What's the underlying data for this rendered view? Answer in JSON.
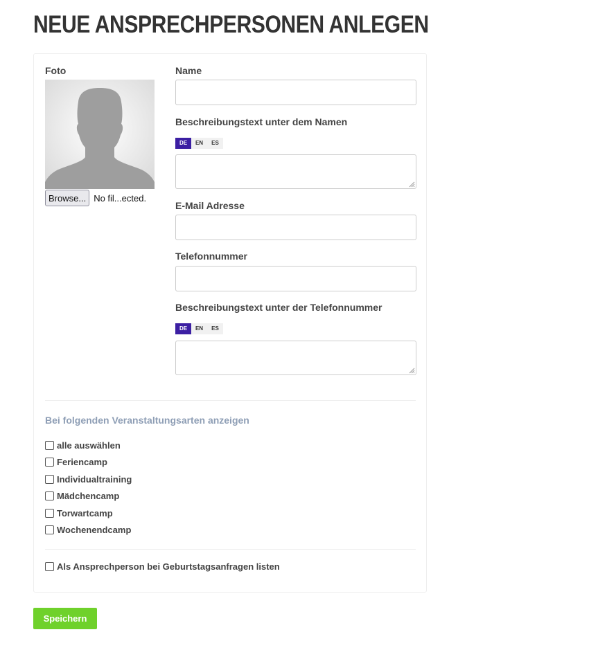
{
  "page": {
    "title": "NEUE ANSPRECHPERSONEN ANLEGEN"
  },
  "photo": {
    "label": "Foto",
    "placeholder_icon": "person-silhouette-icon",
    "browse_label": "Browse...",
    "file_status": "No fil...ected."
  },
  "fields": {
    "name": {
      "label": "Name",
      "value": ""
    },
    "description_name": {
      "label": "Beschreibungstext unter dem Namen",
      "value": ""
    },
    "email": {
      "label": "E-Mail Adresse",
      "value": ""
    },
    "phone": {
      "label": "Telefonnummer",
      "value": ""
    },
    "description_phone": {
      "label": "Beschreibungstext unter der Telefonnummer",
      "value": ""
    }
  },
  "languages": {
    "tabs": [
      "DE",
      "EN",
      "ES"
    ],
    "active": "DE"
  },
  "event_types": {
    "title": "Bei folgenden Veranstaltungsarten anzeigen",
    "items": [
      "alle auswählen",
      "Feriencamp",
      "Individualtraining",
      "Mädchencamp",
      "Torwartcamp",
      "Wochenendcamp"
    ]
  },
  "birthday_option": {
    "label": "Als Ansprechperson bei Geburtstagsanfragen listen"
  },
  "save_button": {
    "label": "Speichern"
  },
  "colors": {
    "accent_lang_active": "#3c1fa3",
    "save_button": "#6fd12b",
    "section_title": "#8e9eb5"
  }
}
